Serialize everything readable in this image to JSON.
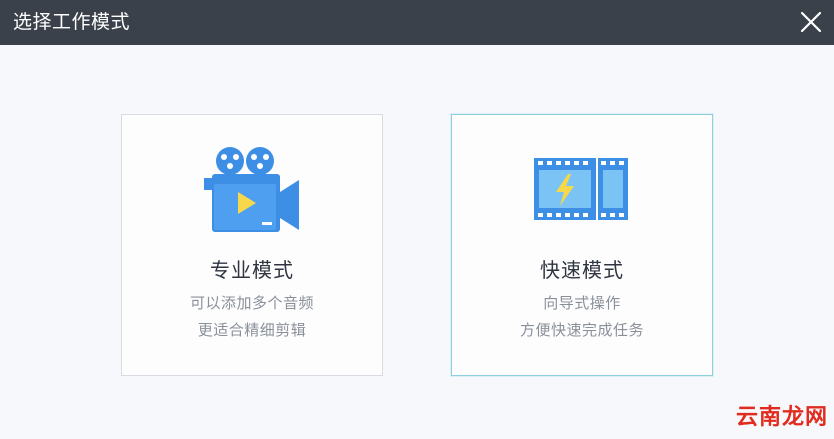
{
  "dialog": {
    "title": "选择工作模式"
  },
  "modes": {
    "pro": {
      "title": "专业模式",
      "desc_line1": "可以添加多个音频",
      "desc_line2": "更适合精细剪辑"
    },
    "fast": {
      "title": "快速模式",
      "desc_line1": "向导式操作",
      "desc_line2": "方便快速完成任务"
    }
  },
  "watermark": {
    "text": "云南龙网"
  },
  "icons": {
    "close": "close-icon",
    "pro": "video-camera-icon",
    "fast": "film-strip-lightning-icon"
  },
  "colors": {
    "titlebar": "#3a414b",
    "icon_blue": "#3d8fe6",
    "icon_light_blue": "#7cc3f5",
    "accent_yellow": "#f7d84a",
    "selected_border": "#8ecfe0",
    "watermark": "#e02b1e"
  }
}
